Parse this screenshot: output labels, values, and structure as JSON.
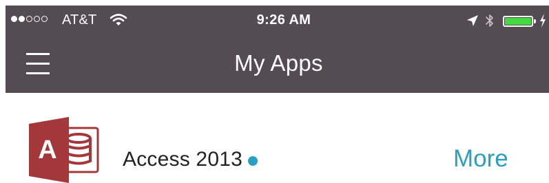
{
  "colors": {
    "nav_background": "#554b53",
    "accent": "#2a9fc4",
    "battery": "#44d940",
    "access_brand": "#a4373a"
  },
  "status_bar": {
    "signal_strength": "2 of 5",
    "carrier": "AT&T",
    "wifi_icon": "wifi-icon",
    "time": "9:26 AM",
    "location_icon": "location-arrow-icon",
    "bluetooth_icon": "bluetooth-icon",
    "battery_level": 1.0,
    "charging_icon": "charging-bolt-icon"
  },
  "nav": {
    "menu_icon": "hamburger-menu-icon",
    "title": "My Apps"
  },
  "apps": [
    {
      "icon": "access-app-icon",
      "icon_letter": "A",
      "name": "Access 2013",
      "has_update_indicator": true,
      "action_label": "More"
    }
  ]
}
